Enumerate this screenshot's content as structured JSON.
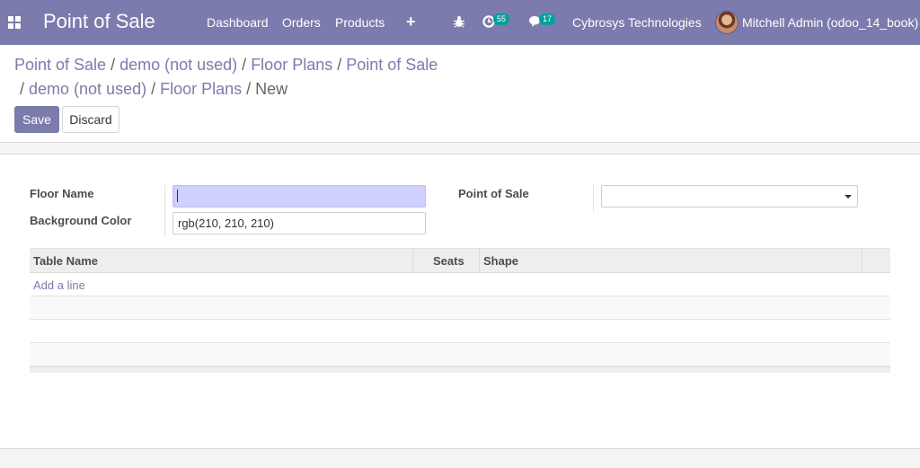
{
  "navbar": {
    "app_title": "Point of Sale",
    "menu": [
      "Dashboard",
      "Orders",
      "Products"
    ],
    "plus_icon": "plus-icon",
    "bug_icon": "bug-icon",
    "activity_icon": "clock-icon",
    "activity_count": "55",
    "chat_icon": "chat-icon",
    "message_count": "17",
    "company": "Cybrosys Technologies",
    "user": "Mitchell Admin (odoo_14_book)",
    "accent_color": "#7c7bad",
    "badge_color": "#00a09d"
  },
  "breadcrumb": {
    "items": [
      "Point of Sale",
      "demo (not used)",
      "Floor Plans",
      "Point of Sale",
      "demo (not used)",
      "Floor Plans"
    ],
    "current": "New",
    "separator": "/"
  },
  "actions": {
    "save_label": "Save",
    "discard_label": "Discard"
  },
  "form": {
    "floor_name_label": "Floor Name",
    "floor_name_value": "",
    "background_color_label": "Background Color",
    "background_color_value": "rgb(210, 210, 210)",
    "pos_label": "Point of Sale",
    "pos_value": ""
  },
  "tables": {
    "columns": [
      "Table Name",
      "Seats",
      "Shape"
    ],
    "add_line_label": "Add a line",
    "rows": []
  }
}
